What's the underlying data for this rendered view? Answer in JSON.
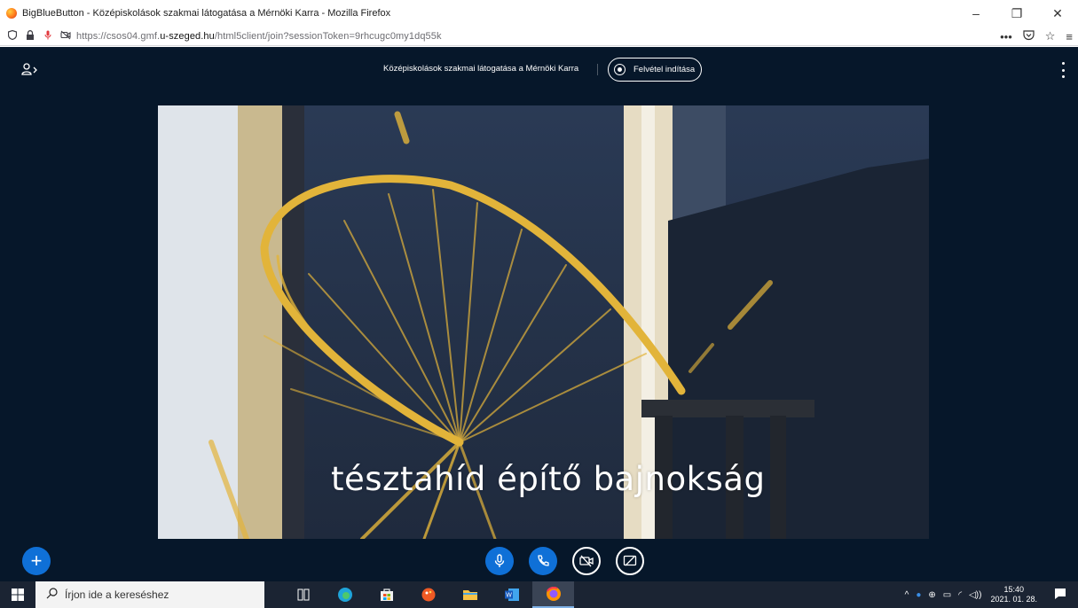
{
  "window": {
    "title": "BigBlueButton - Középiskolások szakmai látogatása a Mérnöki Karra - Mozilla Firefox",
    "controls": {
      "minimize": "–",
      "maximize": "❐",
      "close": "✕"
    }
  },
  "urlbar": {
    "url_prefix": "https://csos04.gmf.",
    "url_host": "u-szeged.hu",
    "url_path": "/html5client/join?sessionToken=9rhcugc0my1dq55k",
    "icons": [
      "shield-icon",
      "lock-icon",
      "microphone-icon",
      "camera-off-icon",
      "more-icon",
      "pocket-icon",
      "bookmark-star-icon",
      "menu-icon"
    ]
  },
  "app": {
    "meeting_title": "Középiskolások szakmai látogatása a Mérnöki Karra",
    "record_label": "Felvétel indítása",
    "video_caption": "tésztahíd építő bajnokság",
    "actions_label": "+"
  },
  "taskbar": {
    "search_placeholder": "Írjon ide a kereséshez",
    "apps": [
      "task-view-icon",
      "edge-icon",
      "store-icon",
      "paint-app-icon",
      "file-explorer-icon",
      "word-icon",
      "firefox-icon"
    ],
    "clock_time": "15:40",
    "clock_date": "2021. 01. 28."
  },
  "colors": {
    "app_background": "#06172a",
    "accent_blue": "#0f70d7",
    "taskbar": "#1b2433"
  }
}
